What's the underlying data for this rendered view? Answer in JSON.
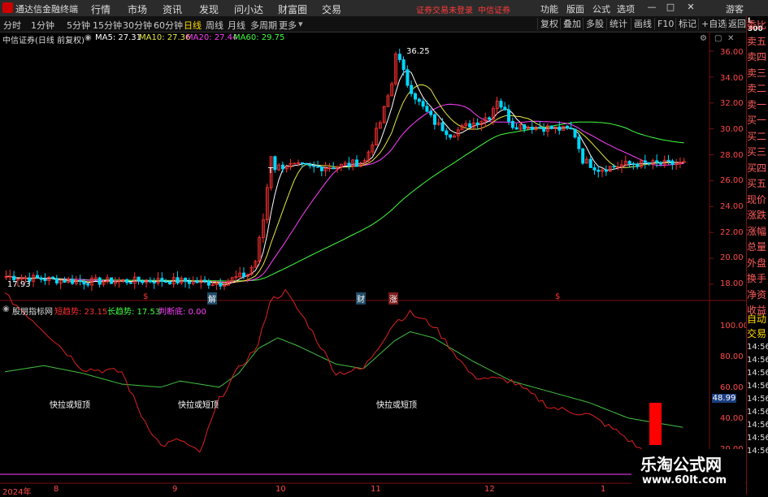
{
  "titlebar": {
    "app_title": "通达信金融终端",
    "menus": [
      "行情",
      "市场",
      "资讯",
      "发现",
      "问小达",
      "财富圈",
      "交易"
    ],
    "alert1": "证券交易未登录",
    "alert2": "中信证券",
    "right_menus": [
      "功能",
      "版面",
      "公式",
      "选项"
    ],
    "guest": "游客"
  },
  "toolbar": {
    "periods": [
      "分时",
      "1分钟",
      "5分钟",
      "15分钟",
      "30分钟",
      "60分钟",
      "日线",
      "周线",
      "月线",
      "多周期",
      "更多"
    ],
    "active_period": "日线",
    "buttons": [
      "复权",
      "叠加",
      "多股",
      "统计",
      "画线",
      "F10",
      "标记",
      "+自选",
      "返回"
    ]
  },
  "main_info": {
    "stock_label": "中信证券(日线 前复权)",
    "ma5": "MA5: 27.31",
    "ma10": "MA10: 27.36",
    "ma20": "MA20: 27.44",
    "ma60": "MA60: 29.75",
    "high_label": "36.25",
    "low_label": "17.93",
    "colors": {
      "ma5": "#ffffff",
      "ma10": "#e8e840",
      "ma20": "#ff40ff",
      "ma60": "#40ff40",
      "up": "#ff3030",
      "down": "#00d8ff"
    }
  },
  "event_marks": [
    "$",
    "解",
    "财",
    "涨",
    "$"
  ],
  "main_axis": {
    "ticks": [
      "36.00",
      "34.00",
      "32.00",
      "30.00",
      "28.00",
      "26.00",
      "24.00",
      "22.00",
      "20.00",
      "18.00"
    ]
  },
  "indicator": {
    "name": "股朋指标网",
    "short_label": "短趋势: 23.15",
    "long_label": "长趋势: 17.53",
    "bottom_label": "判断底: 0.00",
    "signals": [
      "快拉或短顶",
      "快拉或短顶",
      "快拉或短顶"
    ],
    "ticks": [
      "100.00",
      "80.00",
      "60.00",
      "40.00",
      "20.00"
    ],
    "current_value": "48.99"
  },
  "x_axis": [
    "2024年",
    "8",
    "9",
    "10",
    "11",
    "12",
    "1"
  ],
  "right_panel": {
    "labels": [
      "委比",
      "卖五",
      "卖四",
      "卖三",
      "卖二",
      "卖一",
      "买一",
      "买二",
      "买三",
      "买四",
      "买五",
      "现价",
      "涨跌",
      "涨幅",
      "总量",
      "外盘",
      "换手",
      "净资",
      "收益"
    ],
    "lower_labels": [
      "自动",
      "交易"
    ],
    "times": [
      "14:56",
      "14:56",
      "14:56",
      "14:56",
      "14:56",
      "14:56",
      "14:56",
      "14:56",
      "14:56"
    ],
    "corner": "L 300"
  },
  "watermark": {
    "line1": "乐淘公式网",
    "line2": "www.60lt.com"
  }
}
